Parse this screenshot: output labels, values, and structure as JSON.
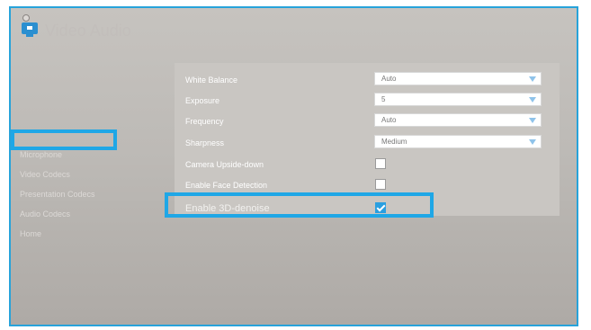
{
  "app": {
    "title": "Video Audio"
  },
  "sidebar": {
    "items": [
      {
        "label": "Microphone"
      },
      {
        "label": "Video Codecs"
      },
      {
        "label": "Presentation Codecs"
      },
      {
        "label": "Audio Codecs"
      },
      {
        "label": "Home"
      }
    ]
  },
  "settings": {
    "white_balance": {
      "label": "White Balance",
      "value": "Auto"
    },
    "exposure": {
      "label": "Exposure",
      "value": "5"
    },
    "frequency": {
      "label": "Frequency",
      "value": "Auto"
    },
    "sharpness": {
      "label": "Sharpness",
      "value": "Medium"
    },
    "camera_upside_down": {
      "label": "Camera Upside-down",
      "checked": false
    },
    "face_detection": {
      "label": "Enable Face Detection",
      "checked": false
    },
    "denoise_3d": {
      "label": "Enable 3D-denoise",
      "checked": true
    }
  },
  "colors": {
    "highlight": "#1fa7e6",
    "frame_border": "#27a3da",
    "checkbox_checked": "#2a9fe0",
    "dropdown_arrow": "#8fc3ea"
  },
  "icons": {
    "app": "monitor-icon",
    "dropdown": "chevron-down-icon",
    "check": "check-icon"
  }
}
